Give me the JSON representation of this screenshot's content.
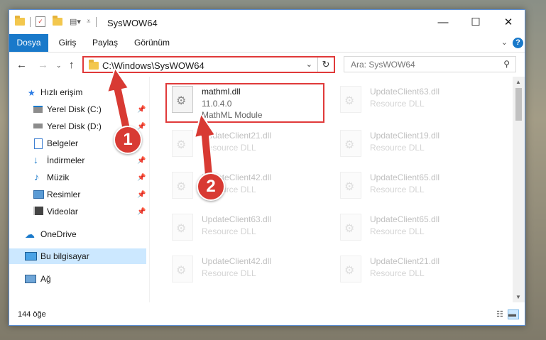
{
  "window": {
    "title": "SysWOW64",
    "controls": {
      "minimize": "—",
      "maximize": "☐",
      "close": "✕"
    }
  },
  "ribbon": {
    "tabs": [
      "Dosya",
      "Giriş",
      "Paylaş",
      "Görünüm"
    ],
    "help": "?"
  },
  "address": {
    "path": "C:\\Windows\\SysWOW64",
    "search_placeholder": "Ara: SysWOW64"
  },
  "sidebar": {
    "quick_access": "Hızlı erişim",
    "items": [
      {
        "label": "Yerel Disk (C:)",
        "icon": "drive-icon"
      },
      {
        "label": "Yerel Disk (D:)",
        "icon": "drive-icon"
      },
      {
        "label": "Belgeler",
        "icon": "documents-icon"
      },
      {
        "label": "İndirmeler",
        "icon": "downloads-icon"
      },
      {
        "label": "Müzik",
        "icon": "music-icon"
      },
      {
        "label": "Resimler",
        "icon": "pictures-icon"
      },
      {
        "label": "Videolar",
        "icon": "videos-icon"
      }
    ],
    "onedrive": "OneDrive",
    "this_pc": "Bu bilgisayar",
    "network": "Ağ"
  },
  "files": {
    "highlighted": {
      "name": "mathml.dll",
      "version": "11.0.4.0",
      "description": "MathML Module"
    },
    "others": [
      {
        "name": "UpdateClient63.dll",
        "type": "Resource DLL"
      },
      {
        "name": "UpdateClient21.dll",
        "type": "Resource DLL"
      },
      {
        "name": "UpdateClient19.dll",
        "type": "Resource DLL"
      },
      {
        "name": "UpdateClient42.dll",
        "type": "Resource DLL"
      },
      {
        "name": "UpdateClient65.dll",
        "type": "Resource DLL"
      },
      {
        "name": "UpdateClient63.dll",
        "type": "Resource DLL"
      },
      {
        "name": "UpdateClient65.dll",
        "type": "Resource DLL"
      },
      {
        "name": "UpdateClient42.dll",
        "type": "Resource DLL"
      },
      {
        "name": "UpdateClient21.dll",
        "type": "Resource DLL"
      }
    ]
  },
  "status": {
    "item_count": "144 öğe"
  },
  "callouts": {
    "one": "1",
    "two": "2"
  },
  "colors": {
    "accent": "#1979ca",
    "highlight": "#e03a3a",
    "callout": "#d83a33",
    "selection": "#cce8ff"
  }
}
